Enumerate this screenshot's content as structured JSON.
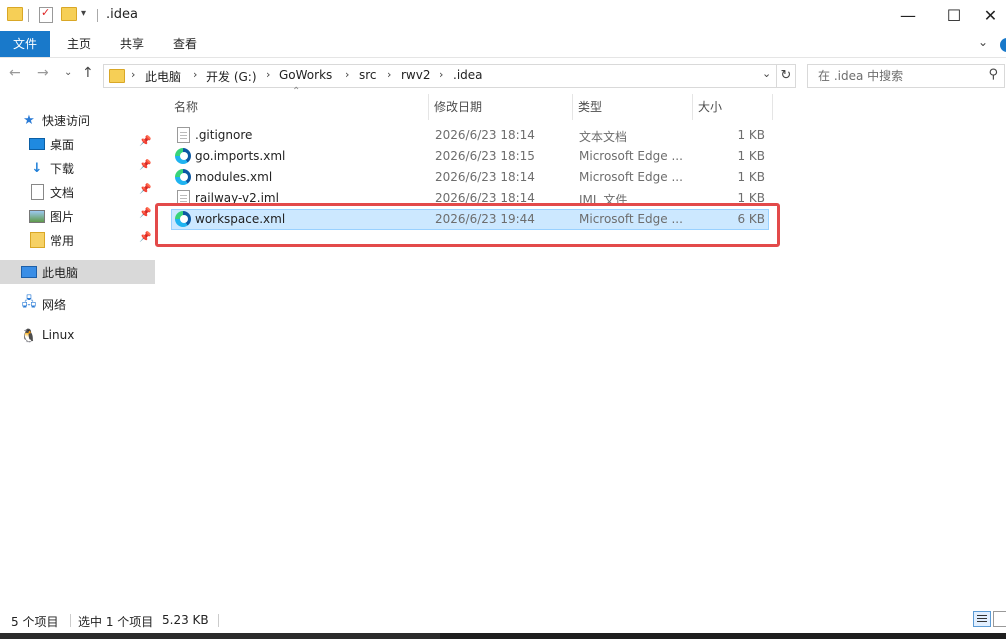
{
  "window": {
    "title": ".idea",
    "minimize": "—",
    "maximize": "☐",
    "close": "✕"
  },
  "ribbon": {
    "tabs": [
      "文件",
      "主页",
      "共享",
      "查看"
    ]
  },
  "address": {
    "breadcrumbs": [
      "此电脑",
      "开发 (G:)",
      "GoWorks",
      "src",
      "rwv2",
      ".idea"
    ],
    "search_placeholder": "在 .idea 中搜索"
  },
  "sidebar": {
    "items": [
      {
        "label": "快速访问",
        "icon": "star-icon",
        "pinned": false
      },
      {
        "label": "桌面",
        "icon": "desktop-icon",
        "pinned": true
      },
      {
        "label": "下载",
        "icon": "download-icon",
        "pinned": true
      },
      {
        "label": "文档",
        "icon": "document-icon",
        "pinned": true
      },
      {
        "label": "图片",
        "icon": "picture-icon",
        "pinned": true
      },
      {
        "label": "常用",
        "icon": "folder-icon",
        "pinned": true
      },
      {
        "label": "此电脑",
        "icon": "computer-icon",
        "pinned": false
      },
      {
        "label": "网络",
        "icon": "network-icon",
        "pinned": false
      },
      {
        "label": "Linux",
        "icon": "linux-icon",
        "pinned": false
      }
    ]
  },
  "columns": {
    "name": "名称",
    "modified": "修改日期",
    "type": "类型",
    "size": "大小"
  },
  "files": [
    {
      "name": ".gitignore",
      "modified": "2026/6/23 18:14",
      "type": "文本文档",
      "size": "1 KB",
      "icon": "text-file-icon"
    },
    {
      "name": "go.imports.xml",
      "modified": "2026/6/23 18:15",
      "type": "Microsoft Edge ...",
      "size": "1 KB",
      "icon": "edge-icon"
    },
    {
      "name": "modules.xml",
      "modified": "2026/6/23 18:14",
      "type": "Microsoft Edge ...",
      "size": "1 KB",
      "icon": "edge-icon"
    },
    {
      "name": "railway-v2.iml",
      "modified": "2026/6/23 18:14",
      "type": "IML 文件",
      "size": "1 KB",
      "icon": "file-icon"
    },
    {
      "name": "workspace.xml",
      "modified": "2026/6/23 19:44",
      "type": "Microsoft Edge ...",
      "size": "6 KB",
      "icon": "edge-icon",
      "selected": true
    }
  ],
  "status": {
    "count": "5 个项目",
    "selected": "选中 1 个项目",
    "size": "5.23 KB"
  },
  "colors": {
    "accent": "#1979ca",
    "selection": "#cce8ff",
    "highlight": "#e34a4a"
  }
}
